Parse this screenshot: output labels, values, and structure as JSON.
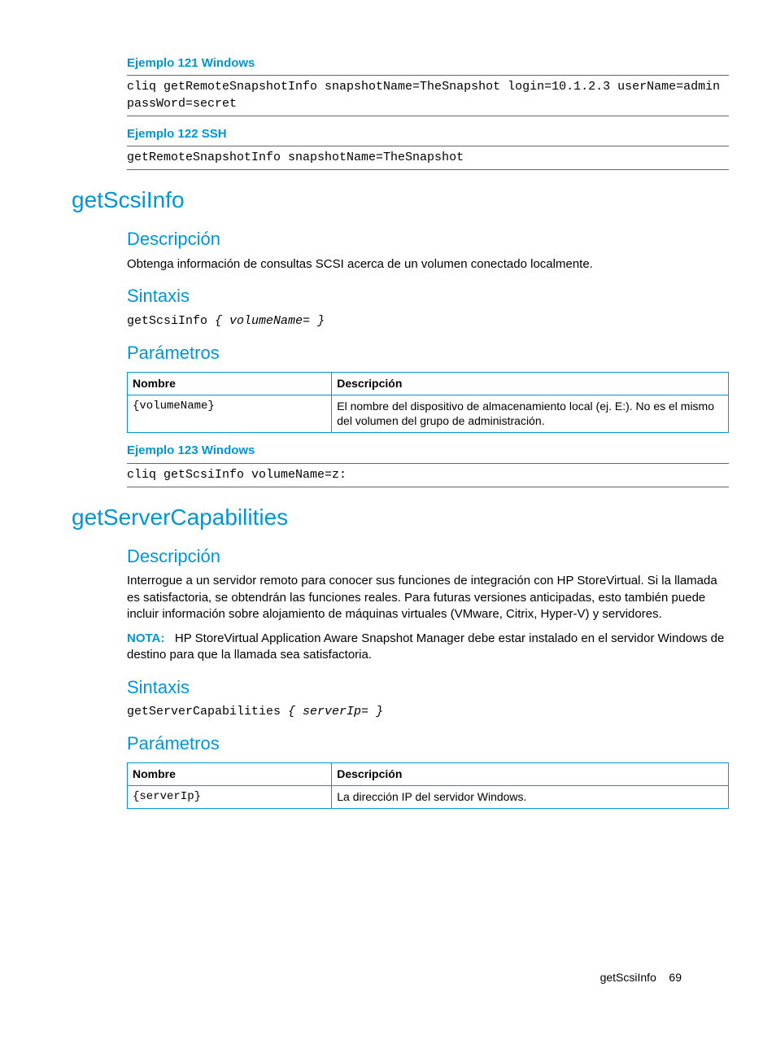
{
  "ex121": {
    "title": "Ejemplo 121 Windows",
    "code": "cliq getRemoteSnapshotInfo snapshotName=TheSnapshot login=10.1.2.3 userName=admin passWord=secret"
  },
  "ex122": {
    "title": "Ejemplo 122 SSH",
    "code": "getRemoteSnapshotInfo snapshotName=TheSnapshot"
  },
  "getScsiInfo": {
    "title": "getScsiInfo",
    "desc_h": "Descripción",
    "desc_p": "Obtenga información de consultas SCSI acerca de un volumen conectado localmente.",
    "syntax_h": "Sintaxis",
    "syntax_cmd": "getScsiInfo",
    "syntax_param": "{ volumeName= }",
    "params_h": "Parámetros",
    "table": {
      "h_name": "Nombre",
      "h_desc": "Descripción",
      "r1_name": "{volumeName}",
      "r1_desc": "El nombre del dispositivo de almacenamiento local (ej. E:). No es el mismo del volumen del grupo de administración."
    },
    "ex123": {
      "title": "Ejemplo 123 Windows",
      "code": "cliq getScsiInfo volumeName=z:"
    }
  },
  "getServerCapabilities": {
    "title": "getServerCapabilities",
    "desc_h": "Descripción",
    "desc_p": "Interrogue a un servidor remoto para conocer sus funciones de integración con HP StoreVirtual. Si la llamada es satisfactoria, se obtendrán las funciones reales. Para futuras versiones anticipadas, esto también puede incluir información sobre alojamiento de máquinas virtuales (VMware, Citrix, Hyper-V) y servidores.",
    "nota_label": "NOTA:",
    "nota_text": "HP StoreVirtual Application Aware Snapshot Manager debe estar instalado en el servidor Windows de destino para que la llamada sea satisfactoria.",
    "syntax_h": "Sintaxis",
    "syntax_cmd": "getServerCapabilities",
    "syntax_param": "{ serverIp= }",
    "params_h": "Parámetros",
    "table": {
      "h_name": "Nombre",
      "h_desc": "Descripción",
      "r1_name": "{serverIp}",
      "r1_desc": "La dirección IP del servidor Windows."
    }
  },
  "footer": {
    "section": "getScsiInfo",
    "page": "69"
  }
}
